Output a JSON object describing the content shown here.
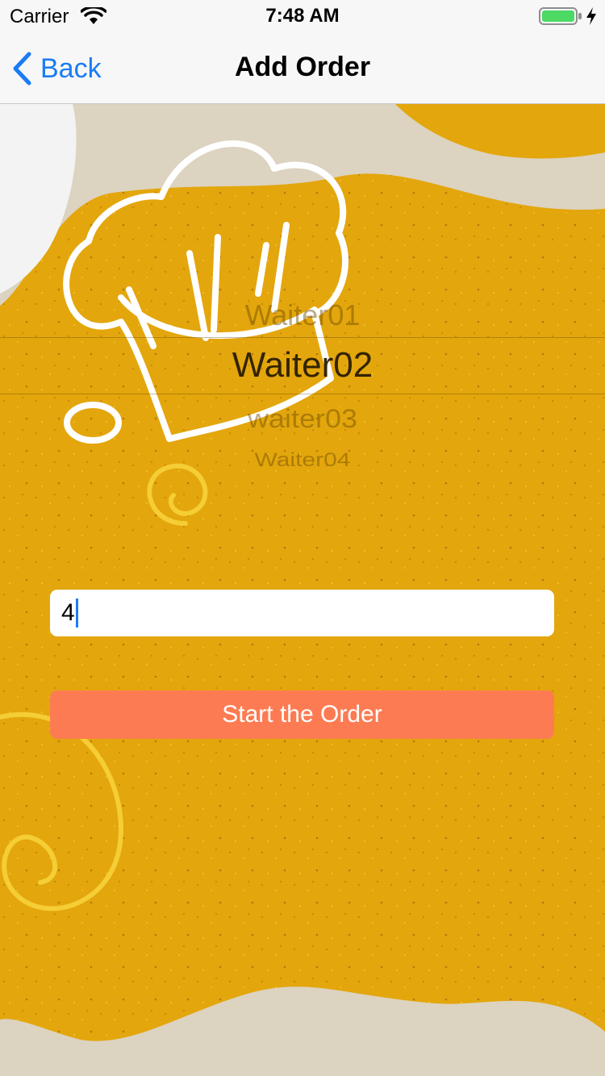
{
  "status_bar": {
    "carrier": "Carrier",
    "time": "7:48 AM",
    "wifi_icon": "wifi-icon",
    "battery_icon": "battery-charging-icon"
  },
  "nav": {
    "back_label": "Back",
    "back_icon": "chevron-left-icon",
    "title": "Add Order"
  },
  "picker": {
    "options": [
      "Waiter01",
      "Waiter02",
      "waiter03",
      "Waiter04"
    ],
    "selected": "Waiter02"
  },
  "table_field": {
    "value": "4",
    "placeholder": ""
  },
  "start_button": {
    "label": "Start the Order"
  },
  "colors": {
    "accent": "#1a7cf5",
    "button": "#fd7b52",
    "background_yellow": "#e6a90a",
    "background_paper": "#dcd3c0"
  }
}
